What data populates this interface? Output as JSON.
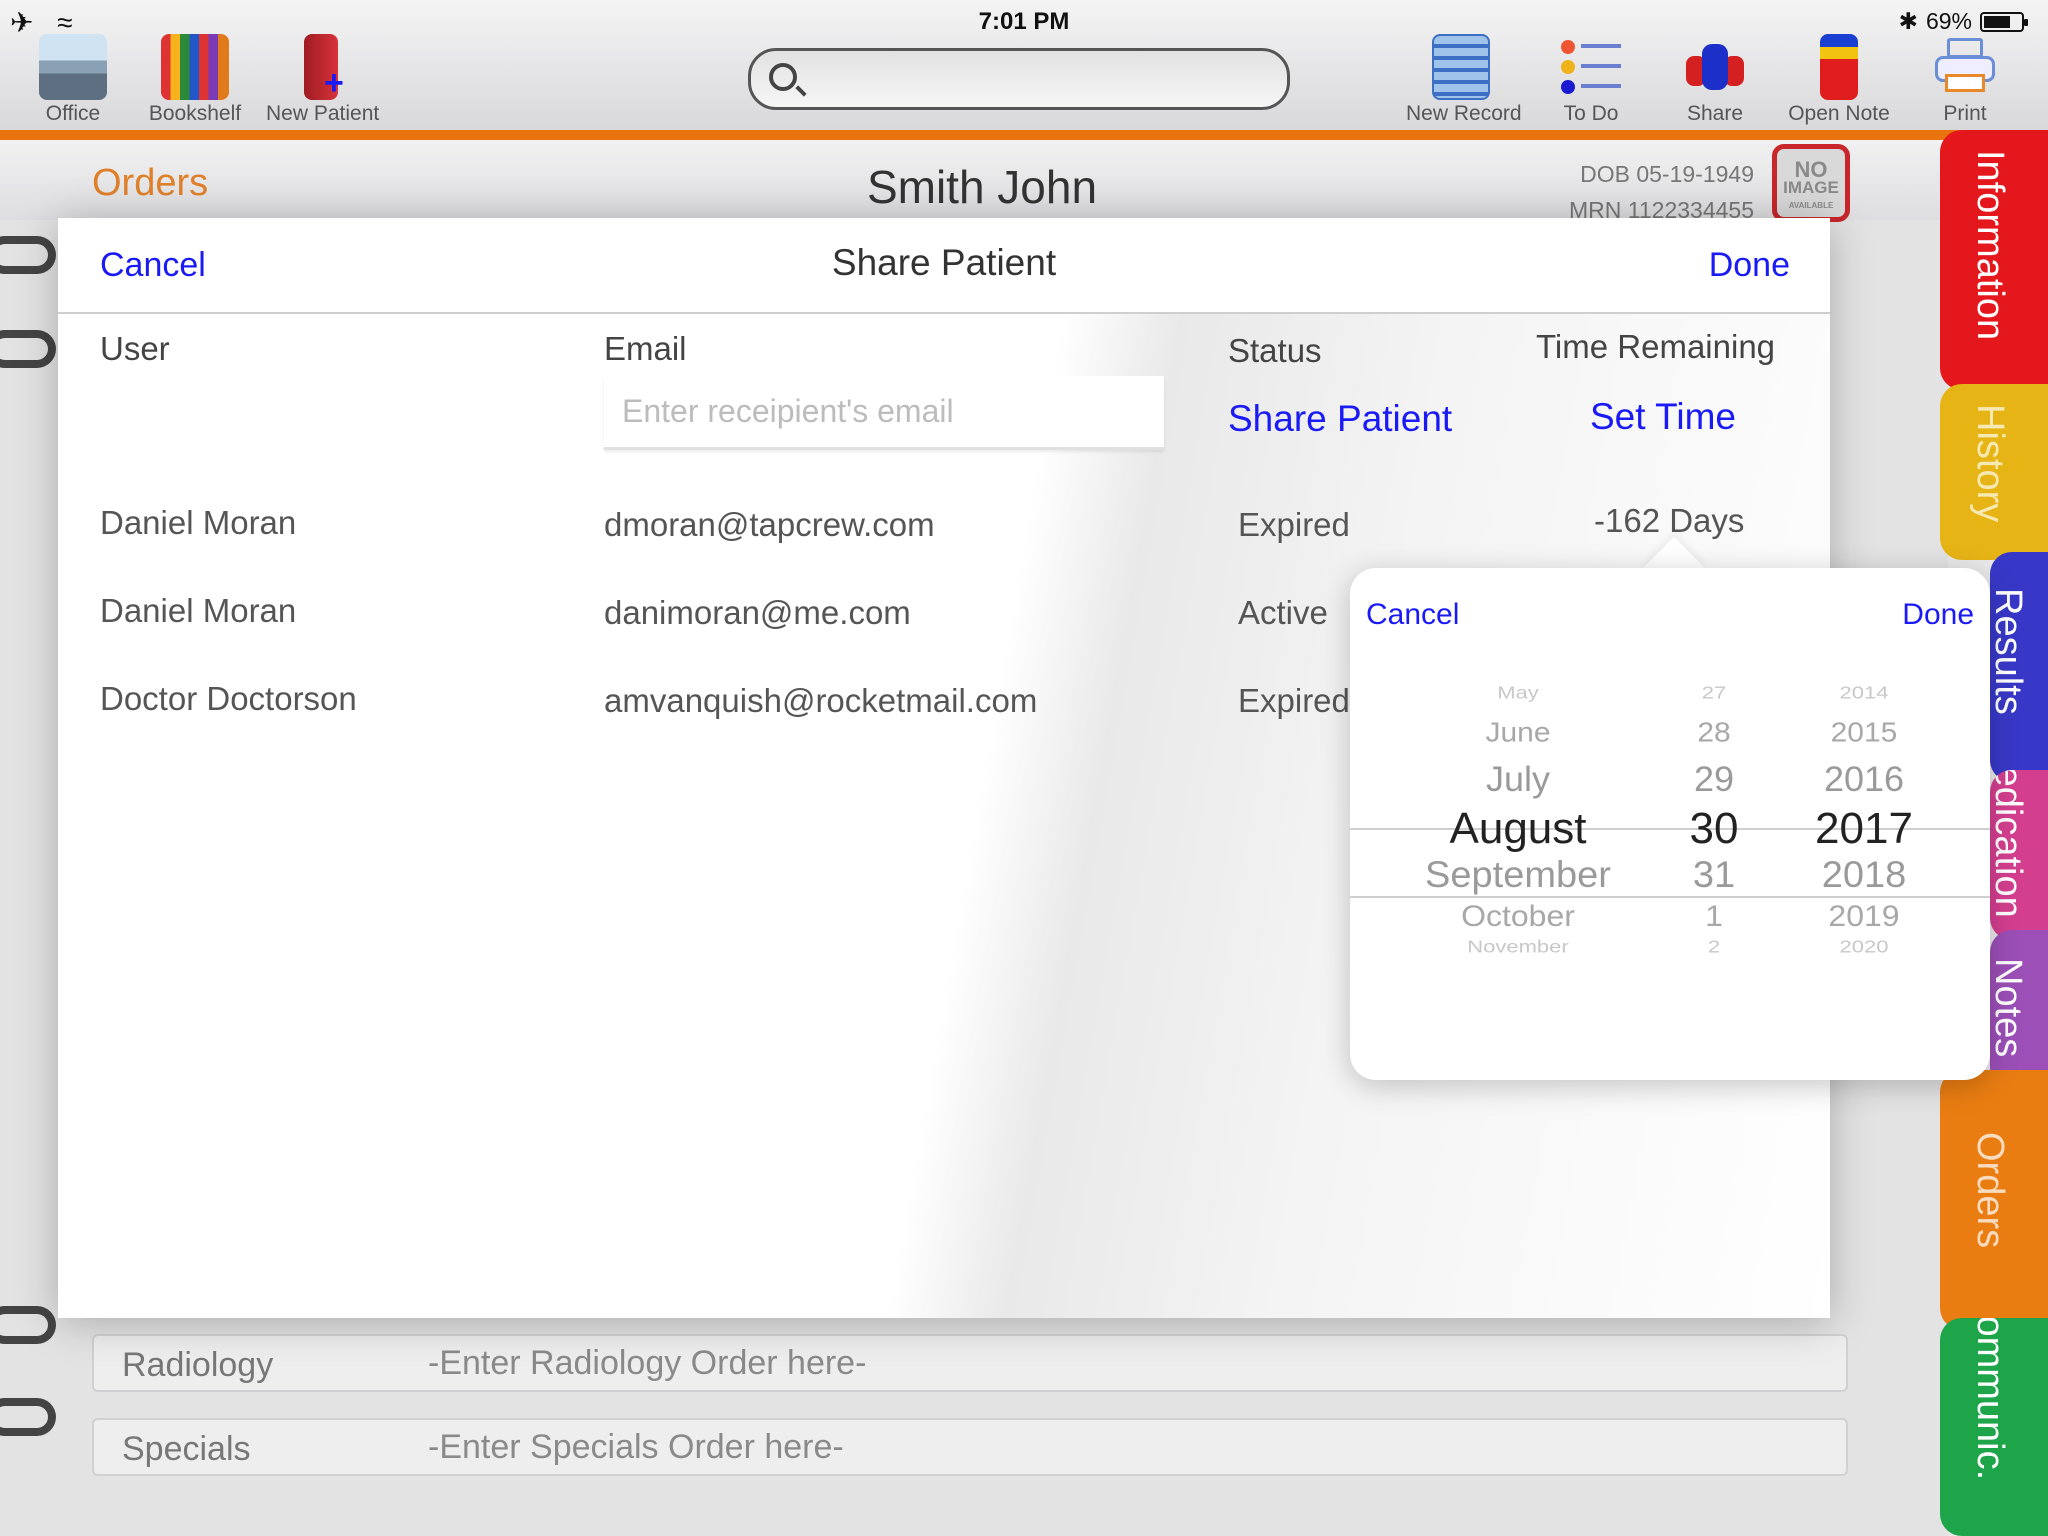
{
  "status_bar": {
    "time": "7:01 PM",
    "battery": "69%"
  },
  "toolbar": {
    "left_tools": [
      {
        "label": "Office"
      },
      {
        "label": "Bookshelf"
      },
      {
        "label": "New Patient"
      }
    ],
    "right_tools": [
      {
        "label": "New Record"
      },
      {
        "label": "To Do"
      },
      {
        "label": "Share"
      },
      {
        "label": "Open Note"
      },
      {
        "label": "Print"
      }
    ]
  },
  "page": {
    "section": "Orders",
    "patient_name": "Smith John",
    "dob": "DOB 05-19-1949",
    "mrn": "MRN 1122334455",
    "photo_text": [
      "NO",
      "IMAGE",
      "AVAILABLE"
    ],
    "orders": [
      {
        "name": "Radiology",
        "hint": "-Enter Radiology Order here-"
      },
      {
        "name": "Specials",
        "hint": "-Enter Specials Order here-"
      }
    ]
  },
  "tabs": [
    {
      "label": "Information",
      "color": "#e4171c"
    },
    {
      "label": "History",
      "color": "#e7b416"
    },
    {
      "label": "Results",
      "color": "#3838c8"
    },
    {
      "label": "Medication",
      "color": "#d43e8f"
    },
    {
      "label": "Notes",
      "color": "#9b4fb7"
    },
    {
      "label": "Orders",
      "color": "#ea7d12"
    },
    {
      "label": "Communic.",
      "color": "#1ea54a"
    }
  ],
  "modal": {
    "title": "Share Patient",
    "cancel": "Cancel",
    "done": "Done",
    "headers": {
      "user": "User",
      "email": "Email",
      "status": "Status",
      "time": "Time Remaining"
    },
    "email_placeholder": "Enter receipient's email",
    "share_link": "Share Patient",
    "set_time_link": "Set Time",
    "rows": [
      {
        "user": "Daniel Moran",
        "email": "dmoran@tapcrew.com",
        "status": "Expired",
        "remaining": "-162 Days"
      },
      {
        "user": "Daniel Moran",
        "email": "danimoran@me.com",
        "status": "Active",
        "remaining": ""
      },
      {
        "user": "Doctor Doctorson",
        "email": "amvanquish@rocketmail.com",
        "status": "Expired",
        "remaining": ""
      }
    ]
  },
  "date_picker": {
    "cancel": "Cancel",
    "done": "Done",
    "months": [
      "May",
      "June",
      "July",
      "August",
      "September",
      "October",
      "November"
    ],
    "days": [
      "27",
      "28",
      "29",
      "30",
      "31",
      "1",
      "2"
    ],
    "years": [
      "2014",
      "2015",
      "2016",
      "2017",
      "2018",
      "2019",
      "2020"
    ],
    "selected": {
      "month": "August",
      "day": "30",
      "year": "2017"
    }
  },
  "colors": {
    "accent_orange": "#e9740f",
    "link_blue": "#1a1af5"
  }
}
